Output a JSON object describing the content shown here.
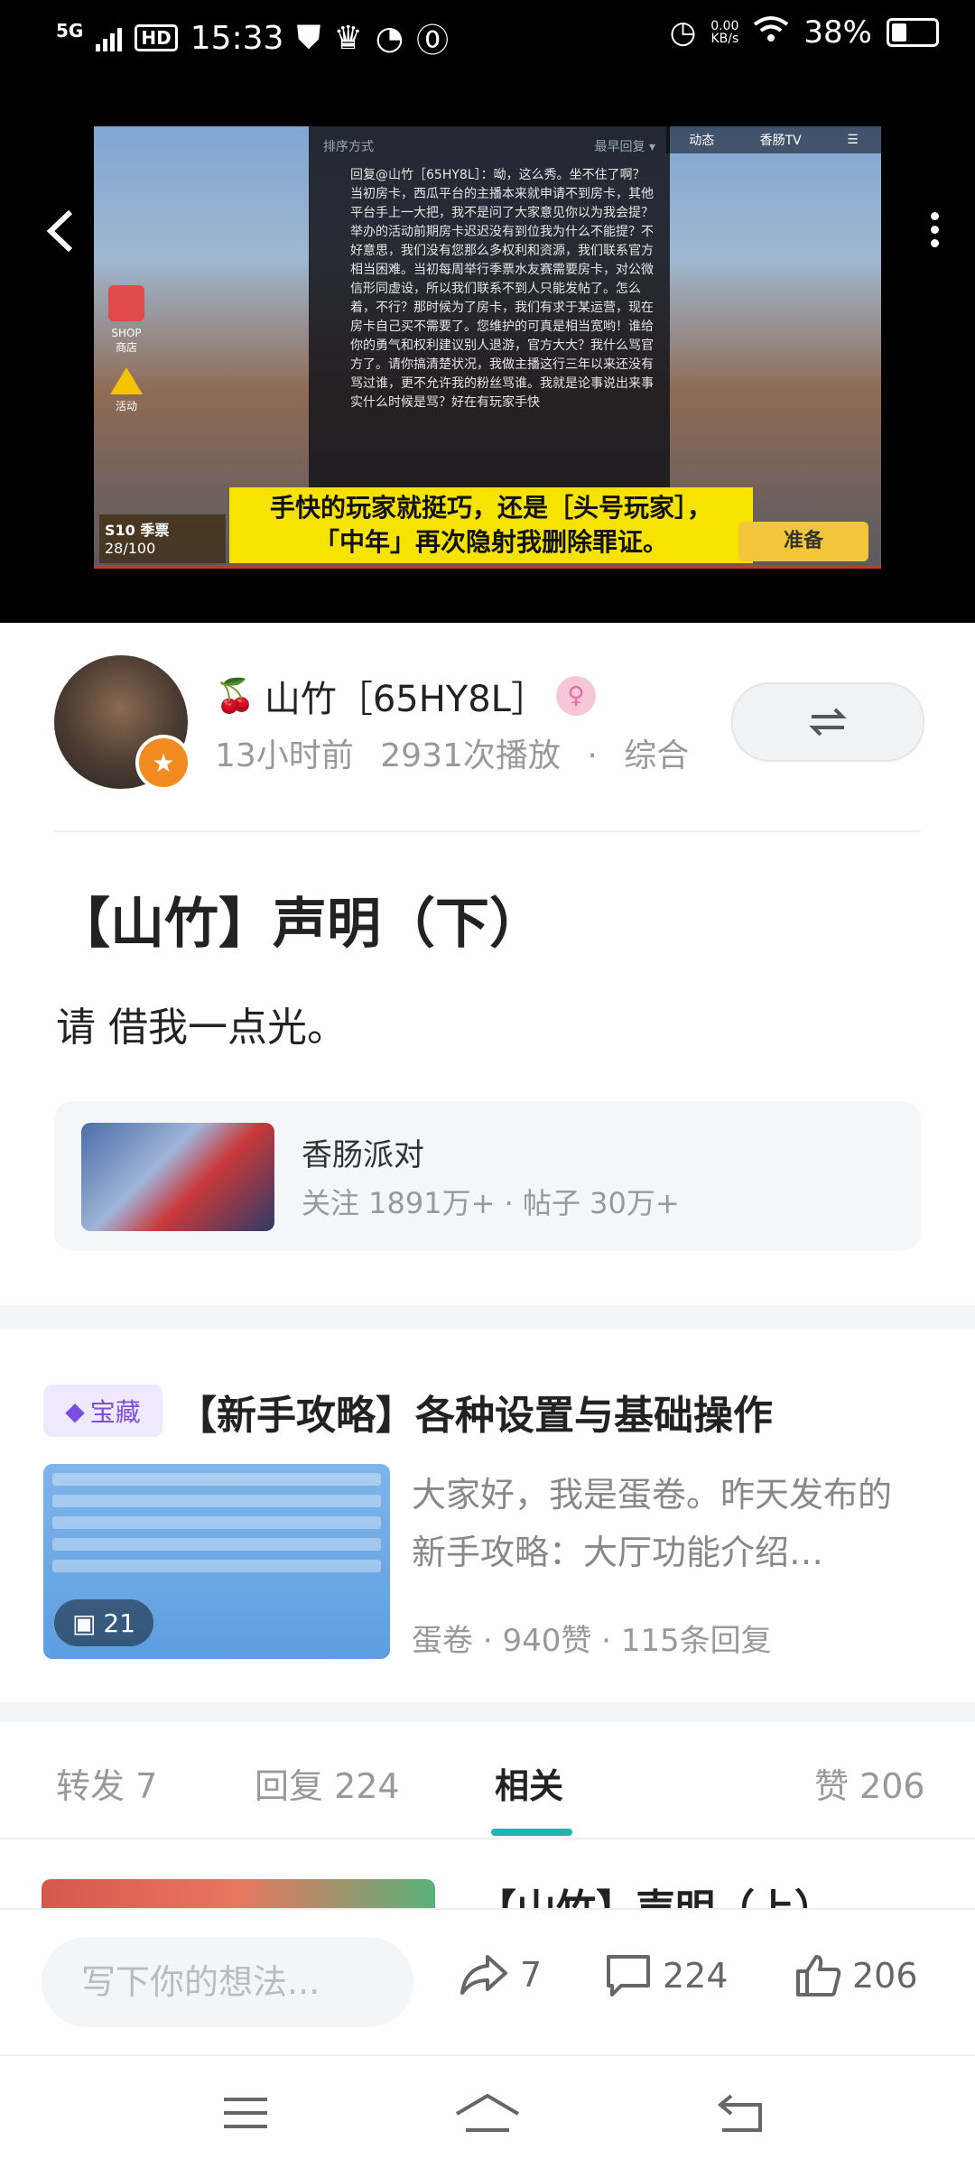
{
  "status_bar": {
    "network": "5G",
    "hd": "HD",
    "time": "15:33",
    "speed_top": "0.00",
    "speed_unit": "KB/s",
    "battery": "38%"
  },
  "video": {
    "subtitle_line1": "手快的玩家就挺巧，还是［头号玩家］，",
    "subtitle_line2": "「中年」再次隐射我删除罪证。",
    "panel_header": "排序方式",
    "panel_sort": "最早回复 ▾",
    "panel_text": "回复@山竹［65HY8L］：呦，这么秀。坐不住了啊？当初房卡，西瓜平台的主播本来就申请不到房卡，其他平台手上一大把，我不是问了大家意见你以为我会提？举办的活动前期房卡迟迟没有到位我为什么不能提？不好意思，我们没有您那么多权利和资源，我们联系官方相当困难。当初每周举行季票水友赛需要房卡，对公微信形同虚设，所以我们联系不到人只能发帖了。怎么着，不行？那时候为了房卡，我们有求于某运营，现在房卡自己买不需要了。您维护的可真是相当宽哟！谁给你的勇气和权利建议别人退游，官方大大？我什么骂官方了。请你搞清楚状况，我做主播这行三年以来还没有骂过谁，更不允许我的粉丝骂谁。我就是论事说出来事实什么时候是骂？好在有玩家手快",
    "top_tab1": "动态",
    "top_tab2": "香肠TV",
    "ready_label": "准备",
    "shop_label": "SHOP 商店",
    "event_label": "活动",
    "season_label": "S10 季票",
    "season_progress": "28/100"
  },
  "author": {
    "name": "山竹［65HY8L］",
    "time": "13小时前",
    "plays": "2931次播放",
    "category": "综合"
  },
  "post": {
    "title": "【山竹】声明（下）",
    "body": "请 借我一点光。"
  },
  "topic": {
    "name": "香肠派对",
    "stats": "关注 1891万+ · 帖子 30万+"
  },
  "recommended": {
    "tag": "宝藏",
    "title": "【新手攻略】各种设置与基础操作",
    "summary": "大家好，我是蛋卷。昨天发布的新手攻略：大厅功能介绍…",
    "image_count": "21",
    "author": "蛋卷",
    "likes": "940赞",
    "replies": "115条回复"
  },
  "tabs": {
    "forward": "转发 7",
    "reply": "回复 224",
    "related": "相关",
    "like": "赞 206"
  },
  "related_preview": {
    "title": "【山竹】声明（上）"
  },
  "bottom": {
    "comment_placeholder": "写下你的想法...",
    "share_count": "7",
    "comment_count": "224",
    "like_count": "206"
  }
}
